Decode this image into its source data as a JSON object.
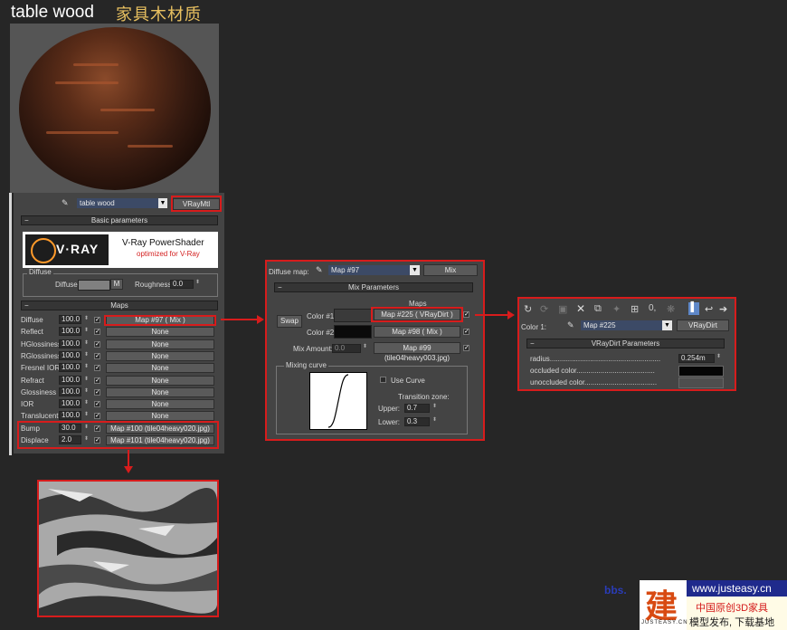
{
  "header": {
    "title": "table wood",
    "subtitle_cn": "家具木材质"
  },
  "material": {
    "name": "table wood",
    "type_button": "VRayMtl"
  },
  "basic": {
    "rollout_label": "Basic parameters",
    "logo_brand": "V·RAY",
    "logo_line1": "V-Ray PowerShader",
    "logo_line2": "optimized for V-Ray",
    "diffuse_group": "Diffuse",
    "diffuse_label": "Diffuse",
    "m_button": "M",
    "roughness_label": "Roughness",
    "roughness_value": "0.0"
  },
  "maps": {
    "rollout_label": "Maps",
    "rows": [
      {
        "label": "Diffuse",
        "amount": "100.0",
        "map": "Map #97  ( Mix )"
      },
      {
        "label": "Reflect",
        "amount": "100.0",
        "map": "None"
      },
      {
        "label": "HGlossiness",
        "amount": "100.0",
        "map": "None"
      },
      {
        "label": "RGlossiness",
        "amount": "100.0",
        "map": "None"
      },
      {
        "label": "Fresnel IOR",
        "amount": "100.0",
        "map": "None"
      },
      {
        "label": "Refract",
        "amount": "100.0",
        "map": "None"
      },
      {
        "label": "Glossiness",
        "amount": "100.0",
        "map": "None"
      },
      {
        "label": "IOR",
        "amount": "100.0",
        "map": "None"
      },
      {
        "label": "Translucent",
        "amount": "100.0",
        "map": "None"
      },
      {
        "label": "Bump",
        "amount": "30.0",
        "map": "Map #100 (tile04heavy020.jpg)"
      },
      {
        "label": "Displace",
        "amount": "2.0",
        "map": "Map #101 (tile04heavy020.jpg)"
      }
    ]
  },
  "mix": {
    "diffuse_map_label": "Diffuse map:",
    "map_name": "Map #97",
    "type_button": "Mix",
    "rollout_label": "Mix Parameters",
    "maps_header": "Maps",
    "swap_button": "Swap",
    "color1_label": "Color #1",
    "color2_label": "Color #2",
    "color1_map": "Map #225  ( VRayDirt )",
    "color2_map": "Map #98  ( Mix )",
    "mix_amount_label": "Mix Amount:",
    "mix_amount_value": "0.0",
    "mix_amount_map": "Map #99 (tile04heavy003.jpg)",
    "mixing_curve_label": "Mixing curve",
    "use_curve_label": "Use Curve",
    "transition_label": "Transition zone:",
    "upper_label": "Upper:",
    "upper_value": "0.7",
    "lower_label": "Lower:",
    "lower_value": "0.3"
  },
  "dirt": {
    "color1_label": "Color 1:",
    "map_name": "Map #225",
    "type_button": "VRayDirt",
    "rollout_label": "VRayDirt Parameters",
    "radius_label": "radius.......................................................",
    "radius_value": "0.254m",
    "occluded_label": "occluded color.......................................",
    "unoccluded_label": "unoccluded color...................................."
  },
  "watermark": {
    "bbs_text": "bbs.",
    "url": "www.justeasy.cn",
    "logo_char": "建",
    "logo_sub": "JUSTEASY.CN",
    "line1_cn": "中国原创3D家具",
    "line2_cn": "模型发布, 下载基地"
  },
  "colors": {
    "accent_red": "#d71c1c",
    "panel_bg": "#444444",
    "page_bg": "#262626"
  }
}
